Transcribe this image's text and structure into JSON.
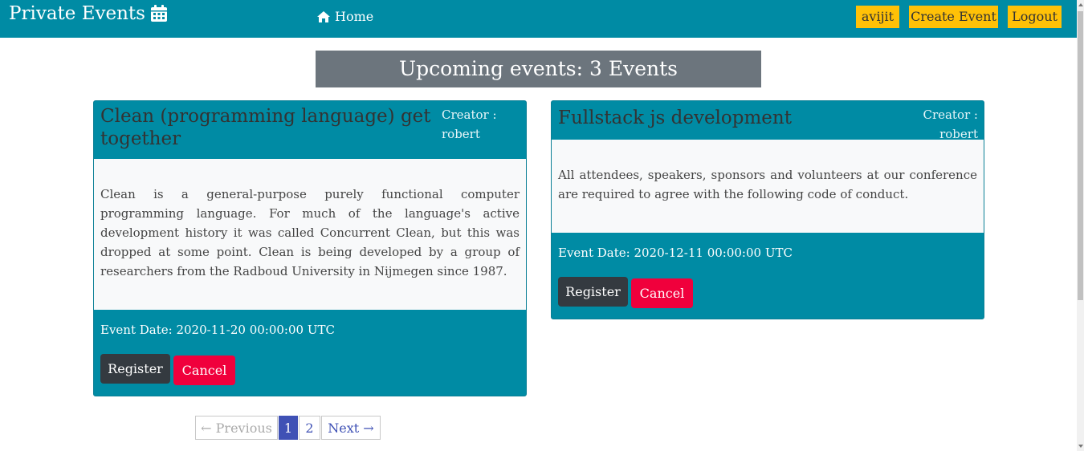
{
  "navbar": {
    "brand": "Private Events",
    "brand_icon": "calendar-icon",
    "home_label": "Home",
    "home_icon": "home-icon",
    "user_label": "avijit",
    "create_label": "Create Event",
    "logout_label": "Logout"
  },
  "colors": {
    "primary": "#008ba4",
    "accent": "#ffc107",
    "banner": "#6c757d",
    "danger": "#f0003c",
    "dark": "#343a40",
    "pagination_active": "#3f51b5"
  },
  "banner": {
    "title": "Upcoming events: 3 Events"
  },
  "events": [
    {
      "title": "Clean (programming language) get together",
      "creator": "Creator : robert",
      "description": "Clean is a general-purpose purely functional computer programming language. For much of the language's active development history it was called Concurrent Clean, but this was dropped at some point. Clean is being developed by a group of researchers from the Radboud University in Nijmegen since 1987.",
      "date": "Event Date: 2020-11-20 00:00:00 UTC",
      "register_label": "Register",
      "cancel_label": "Cancel"
    },
    {
      "title": "Fullstack js development",
      "creator": "Creator : robert",
      "description": "All attendees, speakers, sponsors and volunteers at our conference are required to agree with the following code of conduct.",
      "date": "Event Date: 2020-12-11 00:00:00 UTC",
      "register_label": "Register",
      "cancel_label": "Cancel"
    }
  ],
  "pagination": {
    "previous_label": "← Previous",
    "pages": [
      "1",
      "2"
    ],
    "current": "1",
    "next_label": "Next →"
  }
}
